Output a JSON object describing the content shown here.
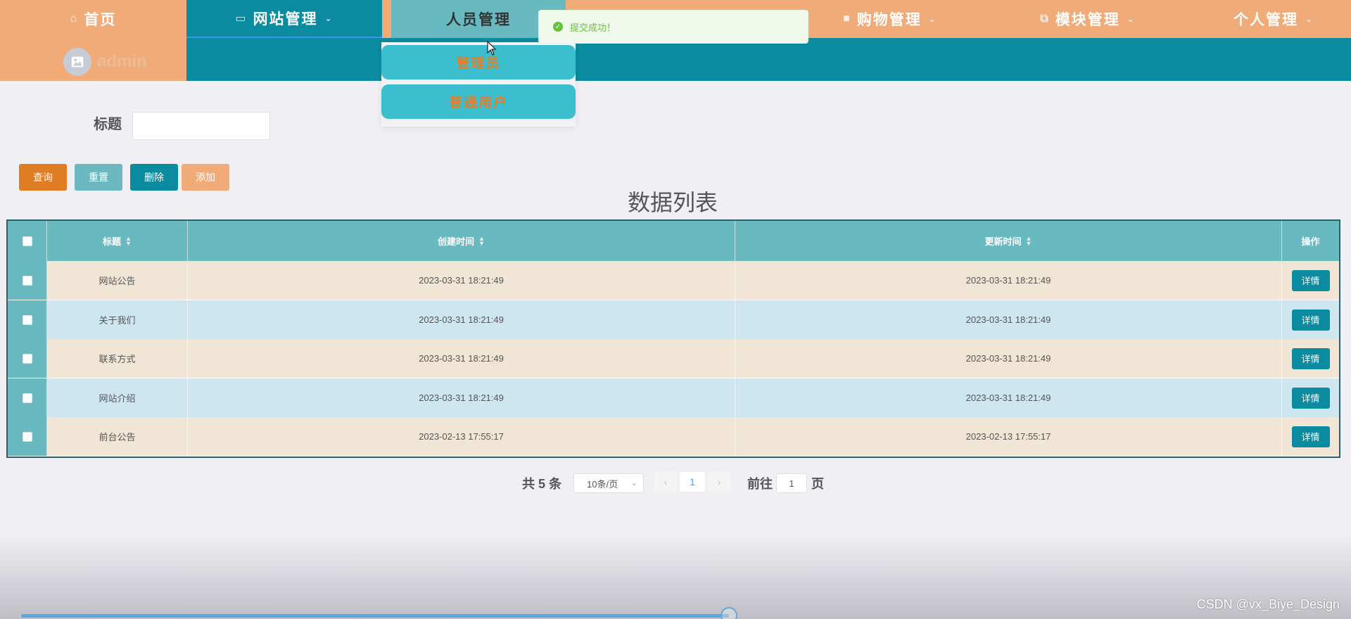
{
  "nav": {
    "home": "首页",
    "site": "网站管理",
    "people": "人员管理",
    "shop": "购物管理",
    "module": "模块管理",
    "personal": "个人管理"
  },
  "user": {
    "name": "admin"
  },
  "dropdown": {
    "items": [
      "管理员",
      "普通用户"
    ]
  },
  "toast": {
    "message": "提交成功！"
  },
  "search": {
    "label": "标题",
    "value": ""
  },
  "buttons": {
    "query": "查询",
    "reset": "重置",
    "delete": "删除",
    "add": "添加"
  },
  "list_title": "数据列表",
  "table": {
    "columns": [
      "标题",
      "创建时间",
      "更新时间",
      "操作"
    ],
    "rows": [
      {
        "title": "网站公告",
        "created": "2023-03-31 18:21:49",
        "updated": "2023-03-31 18:21:49",
        "action": "详情"
      },
      {
        "title": "关于我们",
        "created": "2023-03-31 18:21:49",
        "updated": "2023-03-31 18:21:49",
        "action": "详情"
      },
      {
        "title": "联系方式",
        "created": "2023-03-31 18:21:49",
        "updated": "2023-03-31 18:21:49",
        "action": "详情"
      },
      {
        "title": "网站介绍",
        "created": "2023-03-31 18:21:49",
        "updated": "2023-03-31 18:21:49",
        "action": "详情"
      },
      {
        "title": "前台公告",
        "created": "2023-02-13 17:55:17",
        "updated": "2023-02-13 17:55:17",
        "action": "详情"
      }
    ]
  },
  "pager": {
    "total": "共 5 条",
    "size": "10条/页",
    "page": "1",
    "goto": "前往",
    "goto_value": "1",
    "unit": "页"
  },
  "watermark": "CSDN @vx_Biye_Design",
  "video": {
    "progress_fraction": 0.54
  },
  "colors": {
    "accent": "#0b8b9f",
    "nav": "#f0ab79",
    "teal_light": "#68b9c0",
    "orange": "#e07d24"
  }
}
